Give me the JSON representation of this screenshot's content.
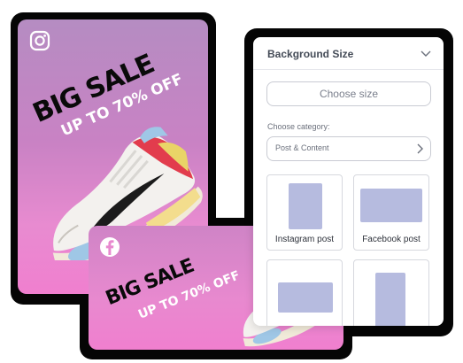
{
  "promo": {
    "big_sale": "BIG SALE",
    "up_to": "UP TO 70% OFF"
  },
  "panel": {
    "title": "Background Size",
    "choose_size": "Choose size",
    "category_label": "Choose category:",
    "category_value": "Post & Content",
    "options": [
      {
        "label": "Instagram post"
      },
      {
        "label": "Facebook post"
      },
      {
        "label": ""
      },
      {
        "label": ""
      }
    ]
  },
  "colors": {
    "card_gradient_top": "#b58cc2",
    "card_gradient_bottom": "#f07fcf",
    "thumb": "#b6bbdf"
  },
  "icons": [
    "instagram-icon",
    "facebook-icon",
    "chevron-down-icon",
    "chevron-right-icon"
  ]
}
